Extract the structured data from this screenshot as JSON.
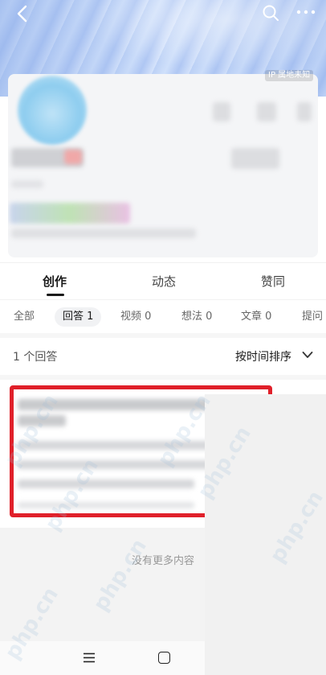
{
  "header": {
    "ip_label": "IP 属地未知"
  },
  "tabs": {
    "main": [
      {
        "label": "创作",
        "active": true
      },
      {
        "label": "动态",
        "active": false
      },
      {
        "label": "赞同",
        "active": false
      }
    ],
    "sub": [
      {
        "label": "全部",
        "active": false
      },
      {
        "label": "回答 1",
        "active": true
      },
      {
        "label": "视频 0",
        "active": false
      },
      {
        "label": "想法 0",
        "active": false
      },
      {
        "label": "文章 0",
        "active": false
      },
      {
        "label": "提问",
        "active": false
      }
    ]
  },
  "answers": {
    "count_label": "1 个回答",
    "sort_label": "按时间排序"
  },
  "footer": {
    "no_more": "没有更多内容"
  },
  "watermark": "php.cn",
  "colors": {
    "highlight": "#e0202a",
    "banner": "#b8cef5"
  },
  "icons": [
    "back-icon",
    "search-icon",
    "more-icon",
    "chevron-down-icon",
    "menu-icon",
    "home-icon"
  ]
}
